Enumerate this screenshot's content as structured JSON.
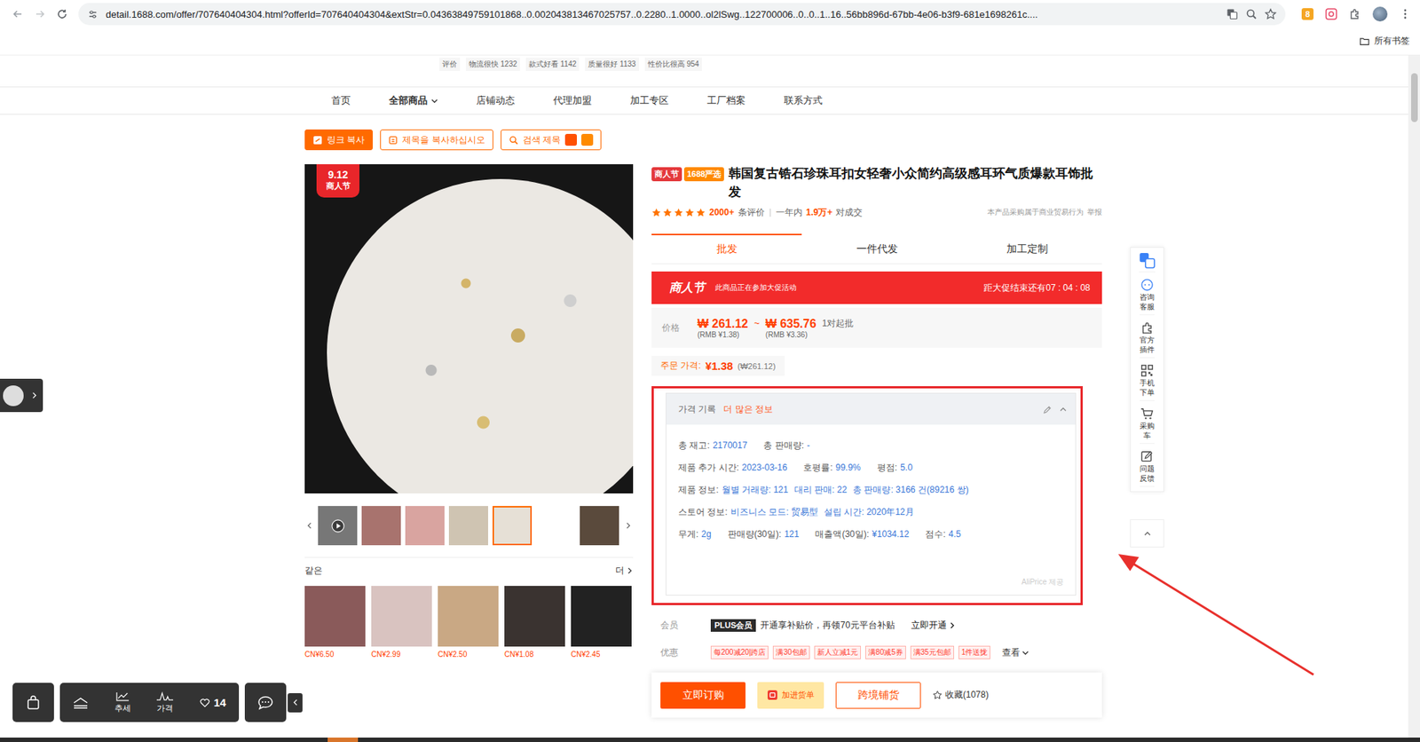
{
  "browser": {
    "url": "detail.1688.com/offer/707640404304.html?offerId=707640404304&extStr=0.04363849759101868..0.002043813467025757..0.2280..1.0000..ol2lSwg..122700006..0..0..1..16..56bb896d-67bb-4e06-b3f9-681e1698261c....",
    "extension_badge": "8",
    "bookmarks": "所有书签"
  },
  "review_strip": [
    "评价",
    "物流很快 1232",
    "款式好看 1142",
    "质量很好 1133",
    "性价比很高 954"
  ],
  "nav": [
    {
      "label": "首页",
      "selected": false,
      "menu": false
    },
    {
      "label": "全部商品",
      "selected": true,
      "menu": true
    },
    {
      "label": "店铺动态",
      "selected": false,
      "menu": false
    },
    {
      "label": "代理加盟",
      "selected": false,
      "menu": false
    },
    {
      "label": "加工专区",
      "selected": false,
      "menu": false
    },
    {
      "label": "工厂档案",
      "selected": false,
      "menu": false
    },
    {
      "label": "联系方式",
      "selected": false,
      "menu": false
    }
  ],
  "tool_buttons": [
    {
      "label": "링크 복사",
      "kind": "primary"
    },
    {
      "label": "제목을 복사하십시오",
      "kind": "outline"
    },
    {
      "label": "검색 제목",
      "kind": "search"
    }
  ],
  "gallery": {
    "badge_date": "9.12",
    "badge_label": "商人节",
    "thumbnails": [
      {
        "kind": "video",
        "selected": false
      },
      {
        "kind": "photo",
        "selected": false
      },
      {
        "kind": "photo",
        "selected": false
      },
      {
        "kind": "photo",
        "selected": false
      },
      {
        "kind": "photo",
        "selected": true
      },
      {
        "kind": "photo",
        "selected": false
      },
      {
        "kind": "photo",
        "selected": false
      }
    ]
  },
  "similar": {
    "title": "같은",
    "more": "더",
    "items": [
      {
        "price": "CN¥6.50"
      },
      {
        "price": "CN¥2.99"
      },
      {
        "price": "CN¥2.50"
      },
      {
        "price": "CN¥1.08"
      },
      {
        "price": "CN¥2.45"
      }
    ]
  },
  "product": {
    "tags": [
      {
        "label": "商人节",
        "color": "#e4393c"
      },
      {
        "label": "1688严选",
        "color": "#ff8a00"
      }
    ],
    "title": "韩国复古锆石珍珠耳扣女轻奢小众简约高级感耳环气质爆款耳饰批发",
    "stars": 5,
    "reviews_count": "2000+",
    "reviews_label": "条评价",
    "sales_label": "一年内",
    "sales_count": "1.9万+",
    "sales_unit": "对成交",
    "notice": "本产品采购属于商业贸易行为",
    "report": "举报"
  },
  "tabs": [
    {
      "label": "批发",
      "selected": true
    },
    {
      "label": "一件代发",
      "selected": false
    },
    {
      "label": "加工定制",
      "selected": false
    }
  ],
  "promo": {
    "badge": "商人节",
    "text": "此商品正在参加大促活动",
    "countdown": "距大促结束还有07 : 04 : 08"
  },
  "price": {
    "label": "价格",
    "low": "₩ 261.12",
    "separator": "~",
    "high": "₩ 635.76",
    "min_order": "1对起批",
    "low_rmb": "(RMB ¥1.38)",
    "high_rmb": "(RMB ¥3.36)"
  },
  "order_price": {
    "label": "주문 가격:",
    "value": "¥1.38",
    "converted": "(₩261.12)"
  },
  "aliprice": {
    "title": "가격 기록",
    "more": "더 많은 정보",
    "expanded": true,
    "rows": [
      [
        {
          "text": "총 재고:",
          "kind": "label"
        },
        {
          "text": "2170017",
          "kind": "value"
        },
        {
          "text": "총 판매량:",
          "kind": "label"
        },
        {
          "text": "-",
          "kind": "value"
        }
      ],
      [
        {
          "text": "제품 추가 시간:",
          "kind": "label"
        },
        {
          "text": "2023-03-16",
          "kind": "value"
        },
        {
          "text": "호평률:",
          "kind": "label"
        },
        {
          "text": "99.9%",
          "kind": "value"
        },
        {
          "text": "평점:",
          "kind": "label"
        },
        {
          "text": "5.0",
          "kind": "value"
        }
      ],
      [
        {
          "text": "제품 정보:",
          "kind": "label"
        },
        {
          "text": "월별 거래량: 121",
          "kind": "value"
        },
        {
          "text": "대리 판매: 22",
          "kind": "value"
        },
        {
          "text": "총 판매량: 3166 건(89216 쌍)",
          "kind": "value"
        }
      ],
      [
        {
          "text": "스토어 정보:",
          "kind": "label"
        },
        {
          "text": "비즈니스 모드: 贸易型",
          "kind": "value"
        },
        {
          "text": "설립 시간: 2020年12月",
          "kind": "value"
        }
      ],
      [
        {
          "text": "무게:",
          "kind": "label"
        },
        {
          "text": "2g",
          "kind": "value"
        },
        {
          "text": "판매량(30일):",
          "kind": "label"
        },
        {
          "text": "121",
          "kind": "value"
        },
        {
          "text": "매출액(30일):",
          "kind": "label"
        },
        {
          "text": "¥1034.12",
          "kind": "value"
        },
        {
          "text": "점수:",
          "kind": "label"
        },
        {
          "text": "4.5",
          "kind": "value"
        }
      ]
    ],
    "footer": "AliPrice 제공"
  },
  "membership": {
    "label": "会员",
    "badge": "PLUS会员",
    "text": "开通享补贴价，再领70元平台补贴",
    "action": "立即开通"
  },
  "discounts": {
    "label": "优惠",
    "tags": [
      "每200减20|跨店",
      "满30包邮",
      "新人立减1元",
      "满80减5券",
      "满35元包邮",
      "1件送拢"
    ],
    "more": "查看"
  },
  "actions": {
    "order": "立即订购",
    "cart": "加进货单",
    "distribute": "跨境铺货",
    "favorite": "收藏(1078)"
  },
  "side_toolbar": [
    {
      "label": "",
      "kind": "translate"
    },
    {
      "label": "咨询客服",
      "kind": "chat"
    },
    {
      "label": "官方插件",
      "kind": "plugin"
    },
    {
      "label": "手机下单",
      "kind": "qr"
    },
    {
      "label": "采购车",
      "kind": "cart"
    },
    {
      "label": "问题反馈",
      "kind": "feedback"
    }
  ],
  "bottom_toolbar": {
    "trend": "추세",
    "price": "가격",
    "likes": "14"
  }
}
